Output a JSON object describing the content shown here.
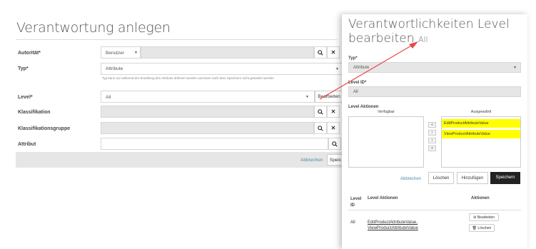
{
  "form": {
    "title": "Verantwortung anlegen",
    "autoritaet": {
      "label": "Autorität*",
      "value": "Benutzer"
    },
    "typ": {
      "label": "Typ*",
      "value": "Attribute",
      "hint": "Typ kann nur während der Erstellung des Attributs definiert werden und kann nach dem Speichern nicht geändert werden"
    },
    "level": {
      "label": "Level*",
      "value": "All",
      "edit_label": "Bearbeiten"
    },
    "klassifikation": {
      "label": "Klassifikation"
    },
    "klassifikationsgruppe": {
      "label": "Klassifikationsgruppe"
    },
    "attribut": {
      "label": "Attribut"
    },
    "footer": {
      "cancel": "Abbrechen",
      "save": "Speic"
    }
  },
  "modal": {
    "title": "Verantwortlichkeiten Level bearbeiten",
    "title_badge": "All",
    "typ": {
      "label": "Typ*",
      "value": "Attribute"
    },
    "level_id": {
      "label": "Level ID*",
      "value": "All"
    },
    "actions_label": "Level Aktionen",
    "available_label": "Verfügbar",
    "selected_label": "Ausgewählt",
    "selected_items": [
      "EditProductAttributeValue",
      "ViewProductAttributeValue"
    ],
    "move_buttons": [
      "«",
      "‹",
      "›",
      "»"
    ],
    "buttons": {
      "cancel": "Abbrechen",
      "delete": "Löschen",
      "add": "Hinzufügen",
      "save": "Speichern"
    },
    "table": {
      "headers": [
        "Level ID",
        "Level Aktionen",
        "Aktionen"
      ],
      "row": {
        "level_id": "All",
        "actions_line1": "EditProductAttributeValue,",
        "actions_line2": "ViewProductAttributeValue",
        "edit": "Bearbeiten",
        "delete": "Löschen"
      }
    }
  },
  "icons": {
    "search": "search-icon",
    "clear": "close-icon",
    "arrow": "red-arrow"
  },
  "colors": {
    "highlight": "#ffff00",
    "dark_button": "#222222",
    "arrow": "#e8464a",
    "link": "#4a90a4"
  }
}
